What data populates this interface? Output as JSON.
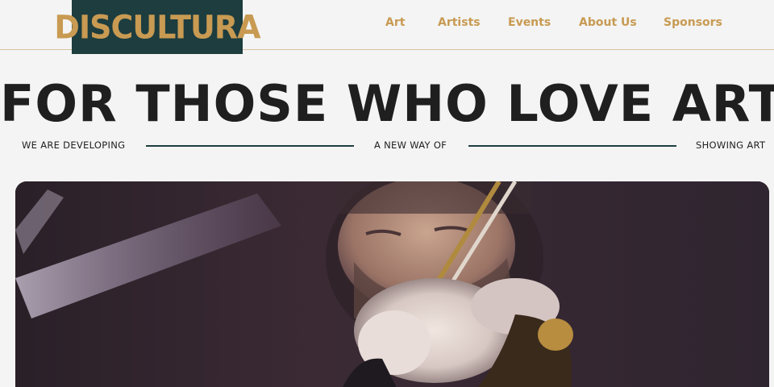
{
  "header": {
    "logo_text": "DISCULTURA",
    "nav": [
      {
        "label": "Art"
      },
      {
        "label": "Artists"
      },
      {
        "label": "Events"
      },
      {
        "label": "About Us"
      },
      {
        "label": "Sponsors"
      }
    ]
  },
  "hero": {
    "title": "FOR THOSE WHO LOVE ART",
    "tagline": [
      "WE ARE DEVELOPING",
      "A NEW WAY OF",
      "SHOWING ART"
    ]
  },
  "media": {
    "alt": "violinist playing video"
  },
  "colors": {
    "brand_dark": "#1d3d3f",
    "brand_gold": "#c89a52",
    "background": "#f3f4f3",
    "text": "#1f1f1f"
  }
}
